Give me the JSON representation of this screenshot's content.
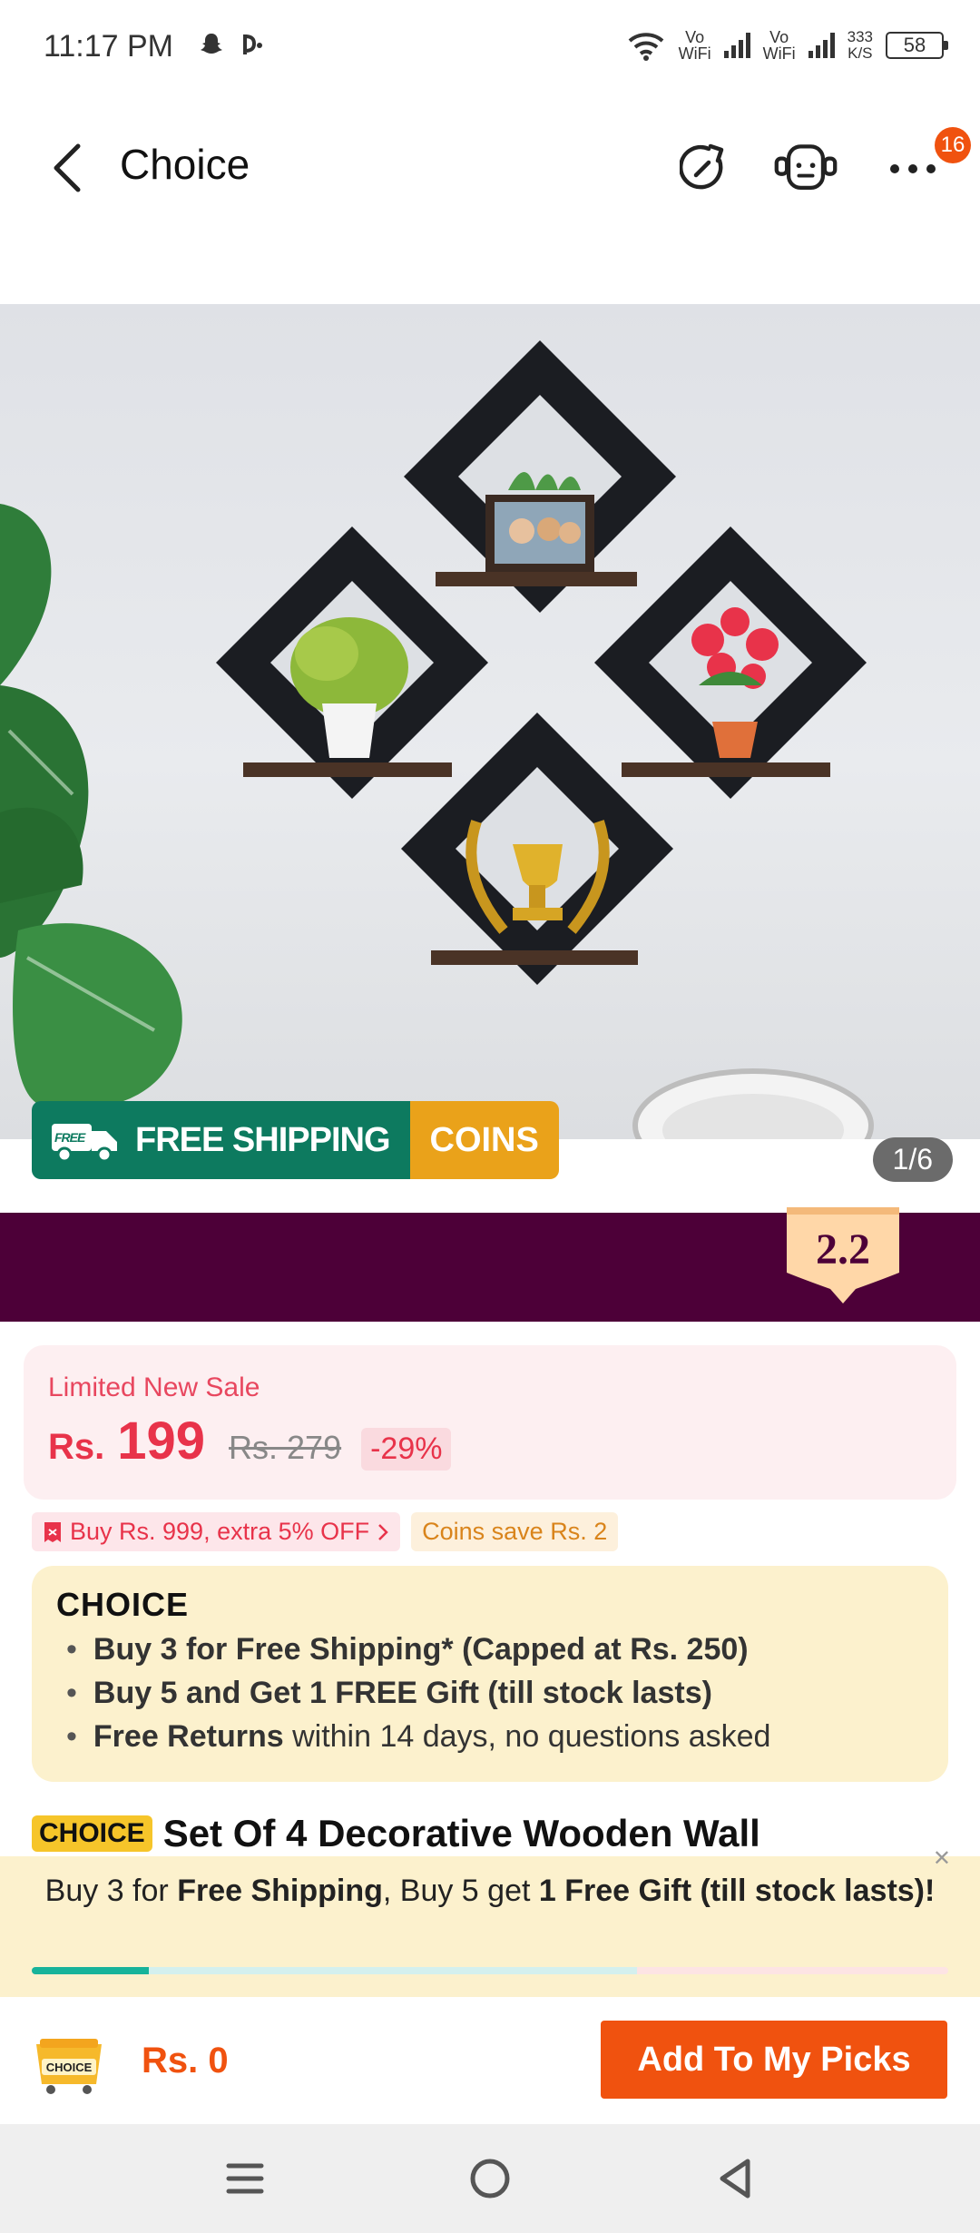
{
  "status": {
    "time": "11:17 PM",
    "net1": "Vo\nWiFi",
    "net2": "Vo\nWiFi",
    "speed_value": "333",
    "speed_unit": "K/S",
    "battery": "58"
  },
  "header": {
    "title": "Choice",
    "badge_count": "16"
  },
  "hero": {
    "counter": "1/6",
    "free_badge": "FREE",
    "free_shipping": "FREE SHIPPING",
    "coins": "COINS"
  },
  "promo": {
    "badge_text": "2.2"
  },
  "price": {
    "label": "Limited New Sale",
    "currency": "Rs.",
    "value": "199",
    "old": "Rs. 279",
    "discount": "-29%"
  },
  "coupons": {
    "offer": "Buy Rs. 999, extra 5% OFF",
    "coins": "Coins save Rs. 2"
  },
  "choice": {
    "logo": "CHOICE",
    "items": [
      {
        "bold": "Buy 3 for  Free Shipping* (Capped at Rs. 250)",
        "rest": ""
      },
      {
        "bold": "Buy 5 and Get 1 FREE Gift (till stock lasts)",
        "rest": ""
      },
      {
        "bold": "Free Returns",
        "rest": " within 14 days, no questions asked"
      }
    ]
  },
  "product": {
    "tag": "CHOICE",
    "name": "Set Of 4 Decorative Wooden Wall"
  },
  "ship_promo": {
    "t1": "Buy 3 for ",
    "b1": "Free Shipping",
    "t2": ", Buy 5 get ",
    "b2": "1 Free Gift (till stock lasts)!",
    "progress": 0.4
  },
  "action": {
    "cart_label": "CHOICE",
    "total": "Rs. 0",
    "add_label": "Add To My Picks"
  },
  "colors": {
    "accent": "#f0520f",
    "green": "#0d7a5f",
    "purple": "#4d0038",
    "price_red": "#e8334a"
  }
}
